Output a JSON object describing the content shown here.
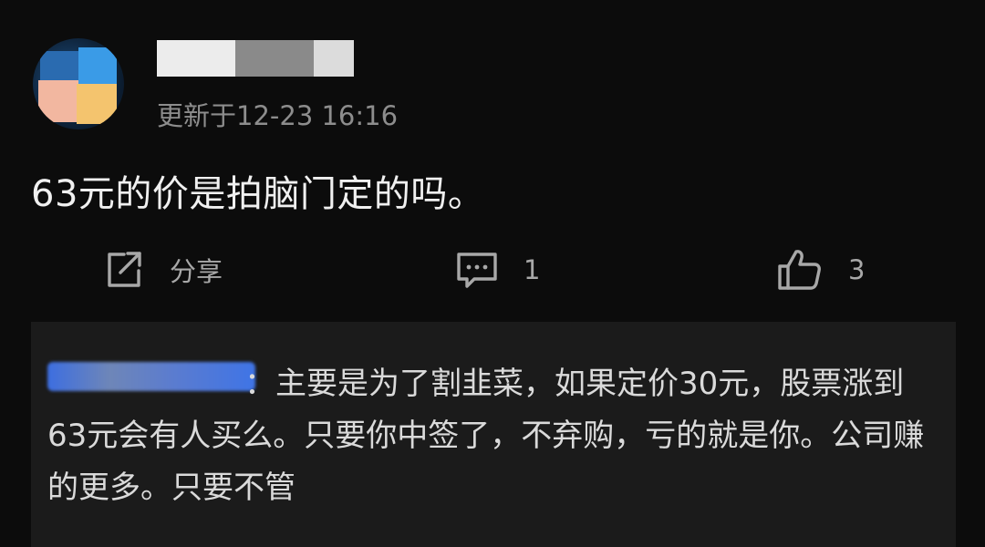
{
  "post": {
    "avatar_icon": "user-avatar",
    "timestamp": "更新于12-23 16:16",
    "content": "63元的价是拍脑门定的吗。"
  },
  "actions": {
    "share": {
      "icon": "share-icon",
      "label": "分享"
    },
    "reply": {
      "icon": "comment-icon",
      "count": "1"
    },
    "like": {
      "icon": "thumbs-up-icon",
      "count": "3"
    }
  },
  "reply": {
    "separator": "：",
    "text": "主要是为了割韭菜，如果定价30元，股票涨到63元会有人买么。只要你中签了，不弃购，亏的就是你。公司赚的更多。只要不管"
  },
  "colors": {
    "background": "#0c0c0c",
    "reply_card": "#1b1b1b",
    "link_blue": "#3f74e6",
    "muted_text": "#8d8d8d"
  }
}
